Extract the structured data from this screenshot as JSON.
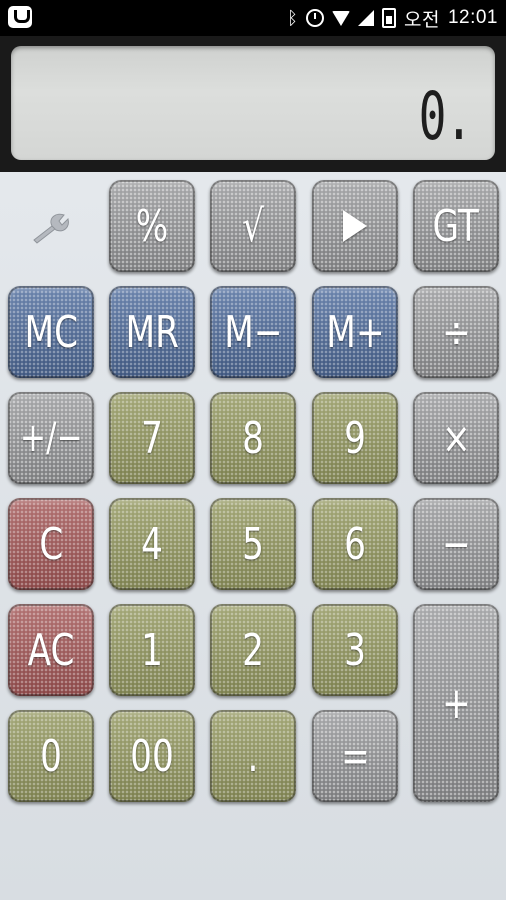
{
  "status_bar": {
    "time_prefix": "오전",
    "time": "12:01"
  },
  "display": {
    "value": "0."
  },
  "keys": {
    "percent": "%",
    "sqrt": "√",
    "gt": "GT",
    "mc": "MC",
    "mr": "MR",
    "m_minus": "M−",
    "m_plus": "M+",
    "divide": "÷",
    "plus_minus": "+/−",
    "seven": "7",
    "eight": "8",
    "nine": "9",
    "multiply": "×",
    "clear": "C",
    "four": "4",
    "five": "5",
    "six": "6",
    "minus": "−",
    "all_clear": "AC",
    "one": "1",
    "two": "2",
    "three": "3",
    "plus": "+",
    "zero": "0",
    "double_zero": "00",
    "decimal": ".",
    "equals": "="
  },
  "icons": {
    "app": "app-badge-icon",
    "bluetooth": "bluetooth-icon",
    "alarm": "alarm-icon",
    "wifi": "wifi-icon",
    "signal": "signal-icon",
    "battery": "battery-icon",
    "settings": "wrench-icon",
    "play": "play-icon"
  },
  "colors": {
    "memory_keys": "#4f6791",
    "number_keys": "#8f9362",
    "clear_keys": "#9c5a5a",
    "function_keys": "#8e8f91",
    "keypad_background": "#e1e5ea"
  }
}
